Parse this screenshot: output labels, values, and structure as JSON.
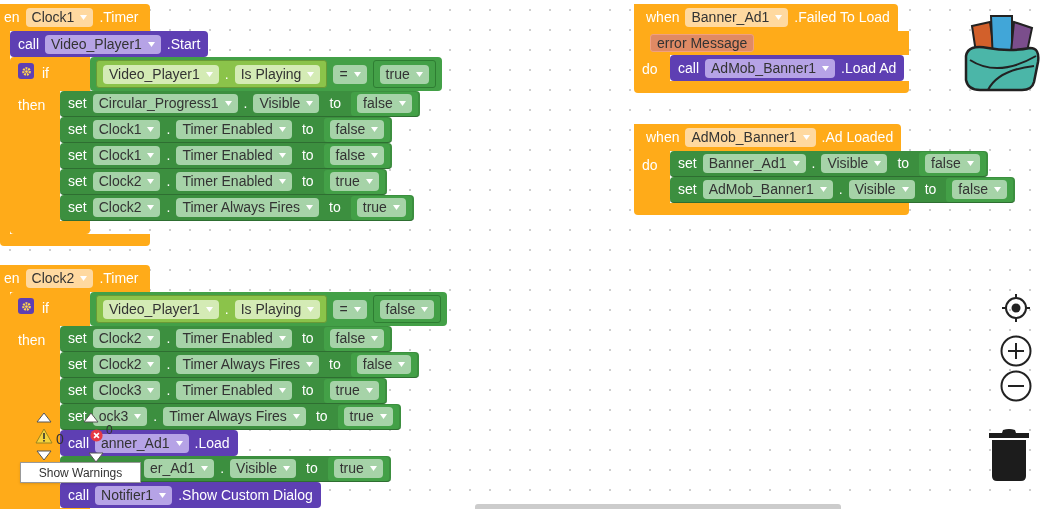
{
  "events": [
    {
      "verb": "en",
      "component": "Clock1",
      "event": ".Timer",
      "body": [
        {
          "kind": "call",
          "verb": "call",
          "component": "Video_Player1",
          "method": ".Start"
        },
        {
          "kind": "if",
          "keyword": "if",
          "then_label": "then",
          "condition": {
            "component": "Video_Player1",
            "dot": ".",
            "property": "Is Playing",
            "operator": "=",
            "value": "true"
          },
          "then": [
            {
              "kind": "set",
              "verb": "set",
              "component": "Circular_Progress1",
              "dot": ".",
              "property": "Visible",
              "to": "to",
              "value": "false"
            },
            {
              "kind": "set",
              "verb": "set",
              "component": "Clock1",
              "dot": ".",
              "property": "Timer Enabled",
              "to": "to",
              "value": "false"
            },
            {
              "kind": "set",
              "verb": "set",
              "component": "Clock1",
              "dot": ".",
              "property": "Timer Enabled",
              "to": "to",
              "value": "false"
            },
            {
              "kind": "set",
              "verb": "set",
              "component": "Clock2",
              "dot": ".",
              "property": "Timer Enabled",
              "to": "to",
              "value": "true"
            },
            {
              "kind": "set",
              "verb": "set",
              "component": "Clock2",
              "dot": ".",
              "property": "Timer Always Fires",
              "to": "to",
              "value": "true"
            }
          ]
        }
      ]
    },
    {
      "verb": "en",
      "component": "Clock2",
      "event": ".Timer",
      "body": [
        {
          "kind": "if",
          "keyword": "if",
          "then_label": "then",
          "condition": {
            "component": "Video_Player1",
            "dot": ".",
            "property": "Is Playing",
            "operator": "=",
            "value": "false"
          },
          "then": [
            {
              "kind": "set",
              "verb": "set",
              "component": "Clock2",
              "dot": ".",
              "property": "Timer Enabled",
              "to": "to",
              "value": "false"
            },
            {
              "kind": "set",
              "verb": "set",
              "component": "Clock2",
              "dot": ".",
              "property": "Timer Always Fires",
              "to": "to",
              "value": "false"
            },
            {
              "kind": "set",
              "verb": "set",
              "component": "Clock3",
              "dot": ".",
              "property": "Timer Enabled",
              "to": "to",
              "value": "true"
            },
            {
              "kind": "set",
              "verb": "set",
              "component": "ock3",
              "dot": ".",
              "property": "Timer Always Fires",
              "to": "to",
              "value": "true"
            },
            {
              "kind": "call",
              "verb": "call",
              "component": "anner_Ad1",
              "method": ".Load"
            },
            {
              "kind": "set",
              "component": "er_Ad1",
              "dot": ".",
              "property": "Visible",
              "to": "to",
              "value": "true"
            },
            {
              "kind": "call",
              "verb": "call",
              "component": "Notifier1",
              "method": ".Show Custom Dialog"
            }
          ]
        }
      ]
    },
    {
      "verb": "when",
      "component": "Banner_Ad1",
      "event": ".Failed To Load",
      "param": "error Message",
      "do_label": "do",
      "body": [
        {
          "kind": "call",
          "verb": "call",
          "component": "AdMob_Banner1",
          "method": ".Load Ad"
        }
      ]
    },
    {
      "verb": "when",
      "component": "AdMob_Banner1",
      "event": ".Ad Loaded",
      "do_label": "do",
      "body": [
        {
          "kind": "set",
          "verb": "set",
          "component": "Banner_Ad1",
          "dot": ".",
          "property": "Visible",
          "to": "to",
          "value": "false"
        },
        {
          "kind": "set",
          "verb": "set",
          "component": "AdMob_Banner1",
          "dot": ".",
          "property": "Visible",
          "to": "to",
          "value": "false"
        }
      ]
    }
  ],
  "indicators": {
    "warnings": "0",
    "errors": "0",
    "tooltip": "Show Warnings"
  }
}
